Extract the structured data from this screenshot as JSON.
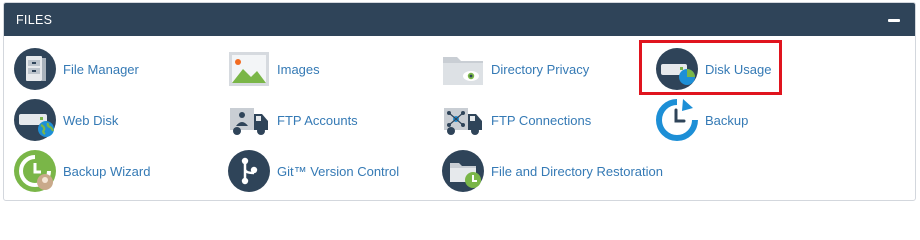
{
  "panel": {
    "title": "FILES",
    "collapse_icon": "minus-icon"
  },
  "items": [
    {
      "label": "File Manager",
      "icon": "file-manager-icon"
    },
    {
      "label": "Images",
      "icon": "images-icon"
    },
    {
      "label": "Directory Privacy",
      "icon": "directory-privacy-icon"
    },
    {
      "label": "Disk Usage",
      "icon": "disk-usage-icon"
    },
    {
      "label": "Web Disk",
      "icon": "web-disk-icon"
    },
    {
      "label": "FTP Accounts",
      "icon": "ftp-accounts-icon"
    },
    {
      "label": "FTP Connections",
      "icon": "ftp-connections-icon"
    },
    {
      "label": "Backup",
      "icon": "backup-icon"
    },
    {
      "label": "Backup Wizard",
      "icon": "backup-wizard-icon"
    },
    {
      "label": "Git™ Version Control",
      "icon": "git-icon"
    },
    {
      "label": "File and Directory Restoration",
      "icon": "file-restoration-icon"
    }
  ],
  "highlight": {
    "target": "Disk Usage",
    "color": "#e0141e"
  },
  "colors": {
    "header_bg": "#2f4459",
    "link": "#357ab5",
    "icon_dark": "#2f4459",
    "icon_blue": "#1d8fd6",
    "icon_green": "#7ab648"
  }
}
